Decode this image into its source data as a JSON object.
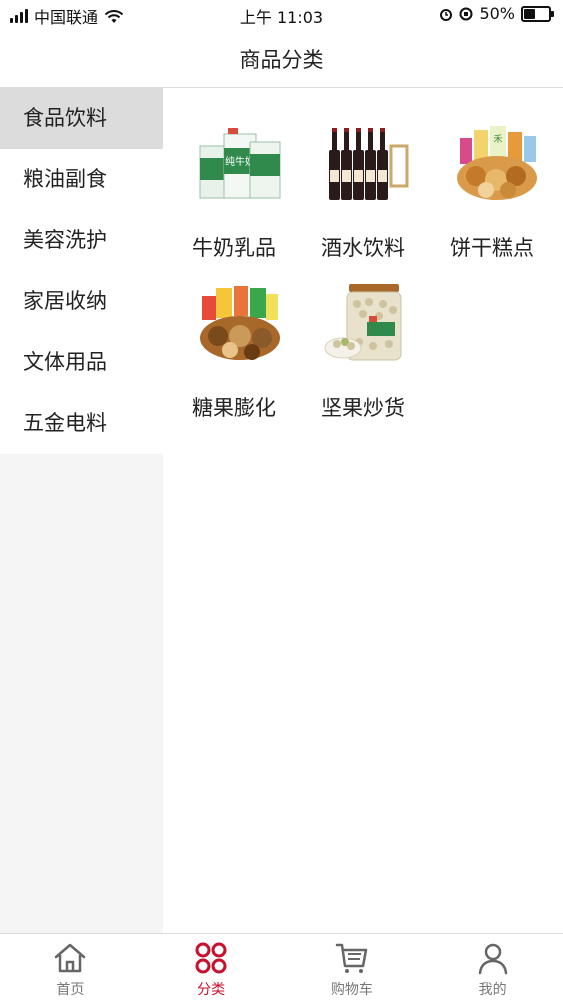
{
  "status_bar": {
    "carrier": "中国联通",
    "time": "上午 11:03",
    "battery": "50%"
  },
  "nav": {
    "title": "商品分类"
  },
  "sidebar": {
    "items": [
      {
        "label": "食品饮料",
        "active": true
      },
      {
        "label": "粮油副食",
        "active": false
      },
      {
        "label": "美容洗护",
        "active": false
      },
      {
        "label": "家居收纳",
        "active": false
      },
      {
        "label": "文体用品",
        "active": false
      },
      {
        "label": "五金电料",
        "active": false
      }
    ]
  },
  "products": [
    {
      "label": "牛奶乳品",
      "icon": "milk-box-image"
    },
    {
      "label": "酒水饮料",
      "icon": "wine-bottles-image"
    },
    {
      "label": "饼干糕点",
      "icon": "biscuits-image"
    },
    {
      "label": "糖果膨化",
      "icon": "snacks-image"
    },
    {
      "label": "坚果炒货",
      "icon": "nuts-jar-image"
    }
  ],
  "tab_bar": {
    "items": [
      {
        "label": "首页",
        "icon": "home-icon",
        "active": false
      },
      {
        "label": "分类",
        "icon": "category-icon",
        "active": true
      },
      {
        "label": "购物车",
        "icon": "cart-icon",
        "active": false
      },
      {
        "label": "我的",
        "icon": "profile-icon",
        "active": false
      }
    ]
  },
  "colors": {
    "accent": "#c8102e",
    "sidebar_active": "#dcdcdc"
  }
}
